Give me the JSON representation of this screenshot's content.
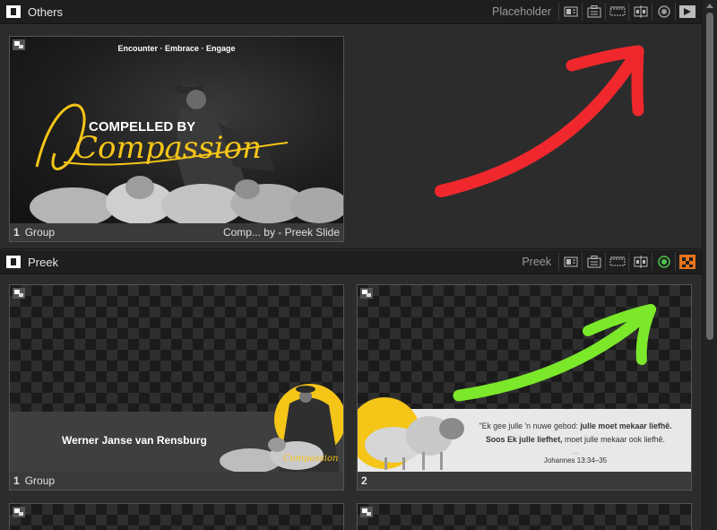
{
  "sections": [
    {
      "title": "Others",
      "label": "Placeholder",
      "slides": [
        {
          "num": "1",
          "group": "Group",
          "name": "Comp... by - Preek Slide",
          "tagline": "Encounter · Embrace · Engage",
          "heading_top": "COMPELLED BY",
          "heading_script": "Compassion"
        }
      ]
    },
    {
      "title": "Preek",
      "label": "Preek",
      "slides": [
        {
          "num": "1",
          "group": "Group",
          "speaker": "Werner Janse van Rensburg",
          "mini_script": "Compassion"
        },
        {
          "num": "2",
          "verse_plain1": "\"Ek gee julle 'n nuwe gebod: ",
          "verse_bold1": "julle moet mekaar liefhê.",
          "verse_bold2": "Soos Ek julle liefhet,",
          "verse_plain2": " moet julle mekaar ook liefhê.",
          "reference": "Johannes 13:34–35",
          "ellipsis": "..."
        }
      ]
    }
  ],
  "colors": {
    "red_arrow": "#f0282d",
    "green_arrow": "#7be82a",
    "yellow": "#f5c518",
    "accent_orange": "#e8731a",
    "accent_green": "#4cc44c"
  },
  "icons": [
    "logo-icon",
    "stage-icon",
    "projector-icon",
    "timer-icon",
    "split-icon",
    "record-icon",
    "play-icon",
    "checker-icon"
  ]
}
